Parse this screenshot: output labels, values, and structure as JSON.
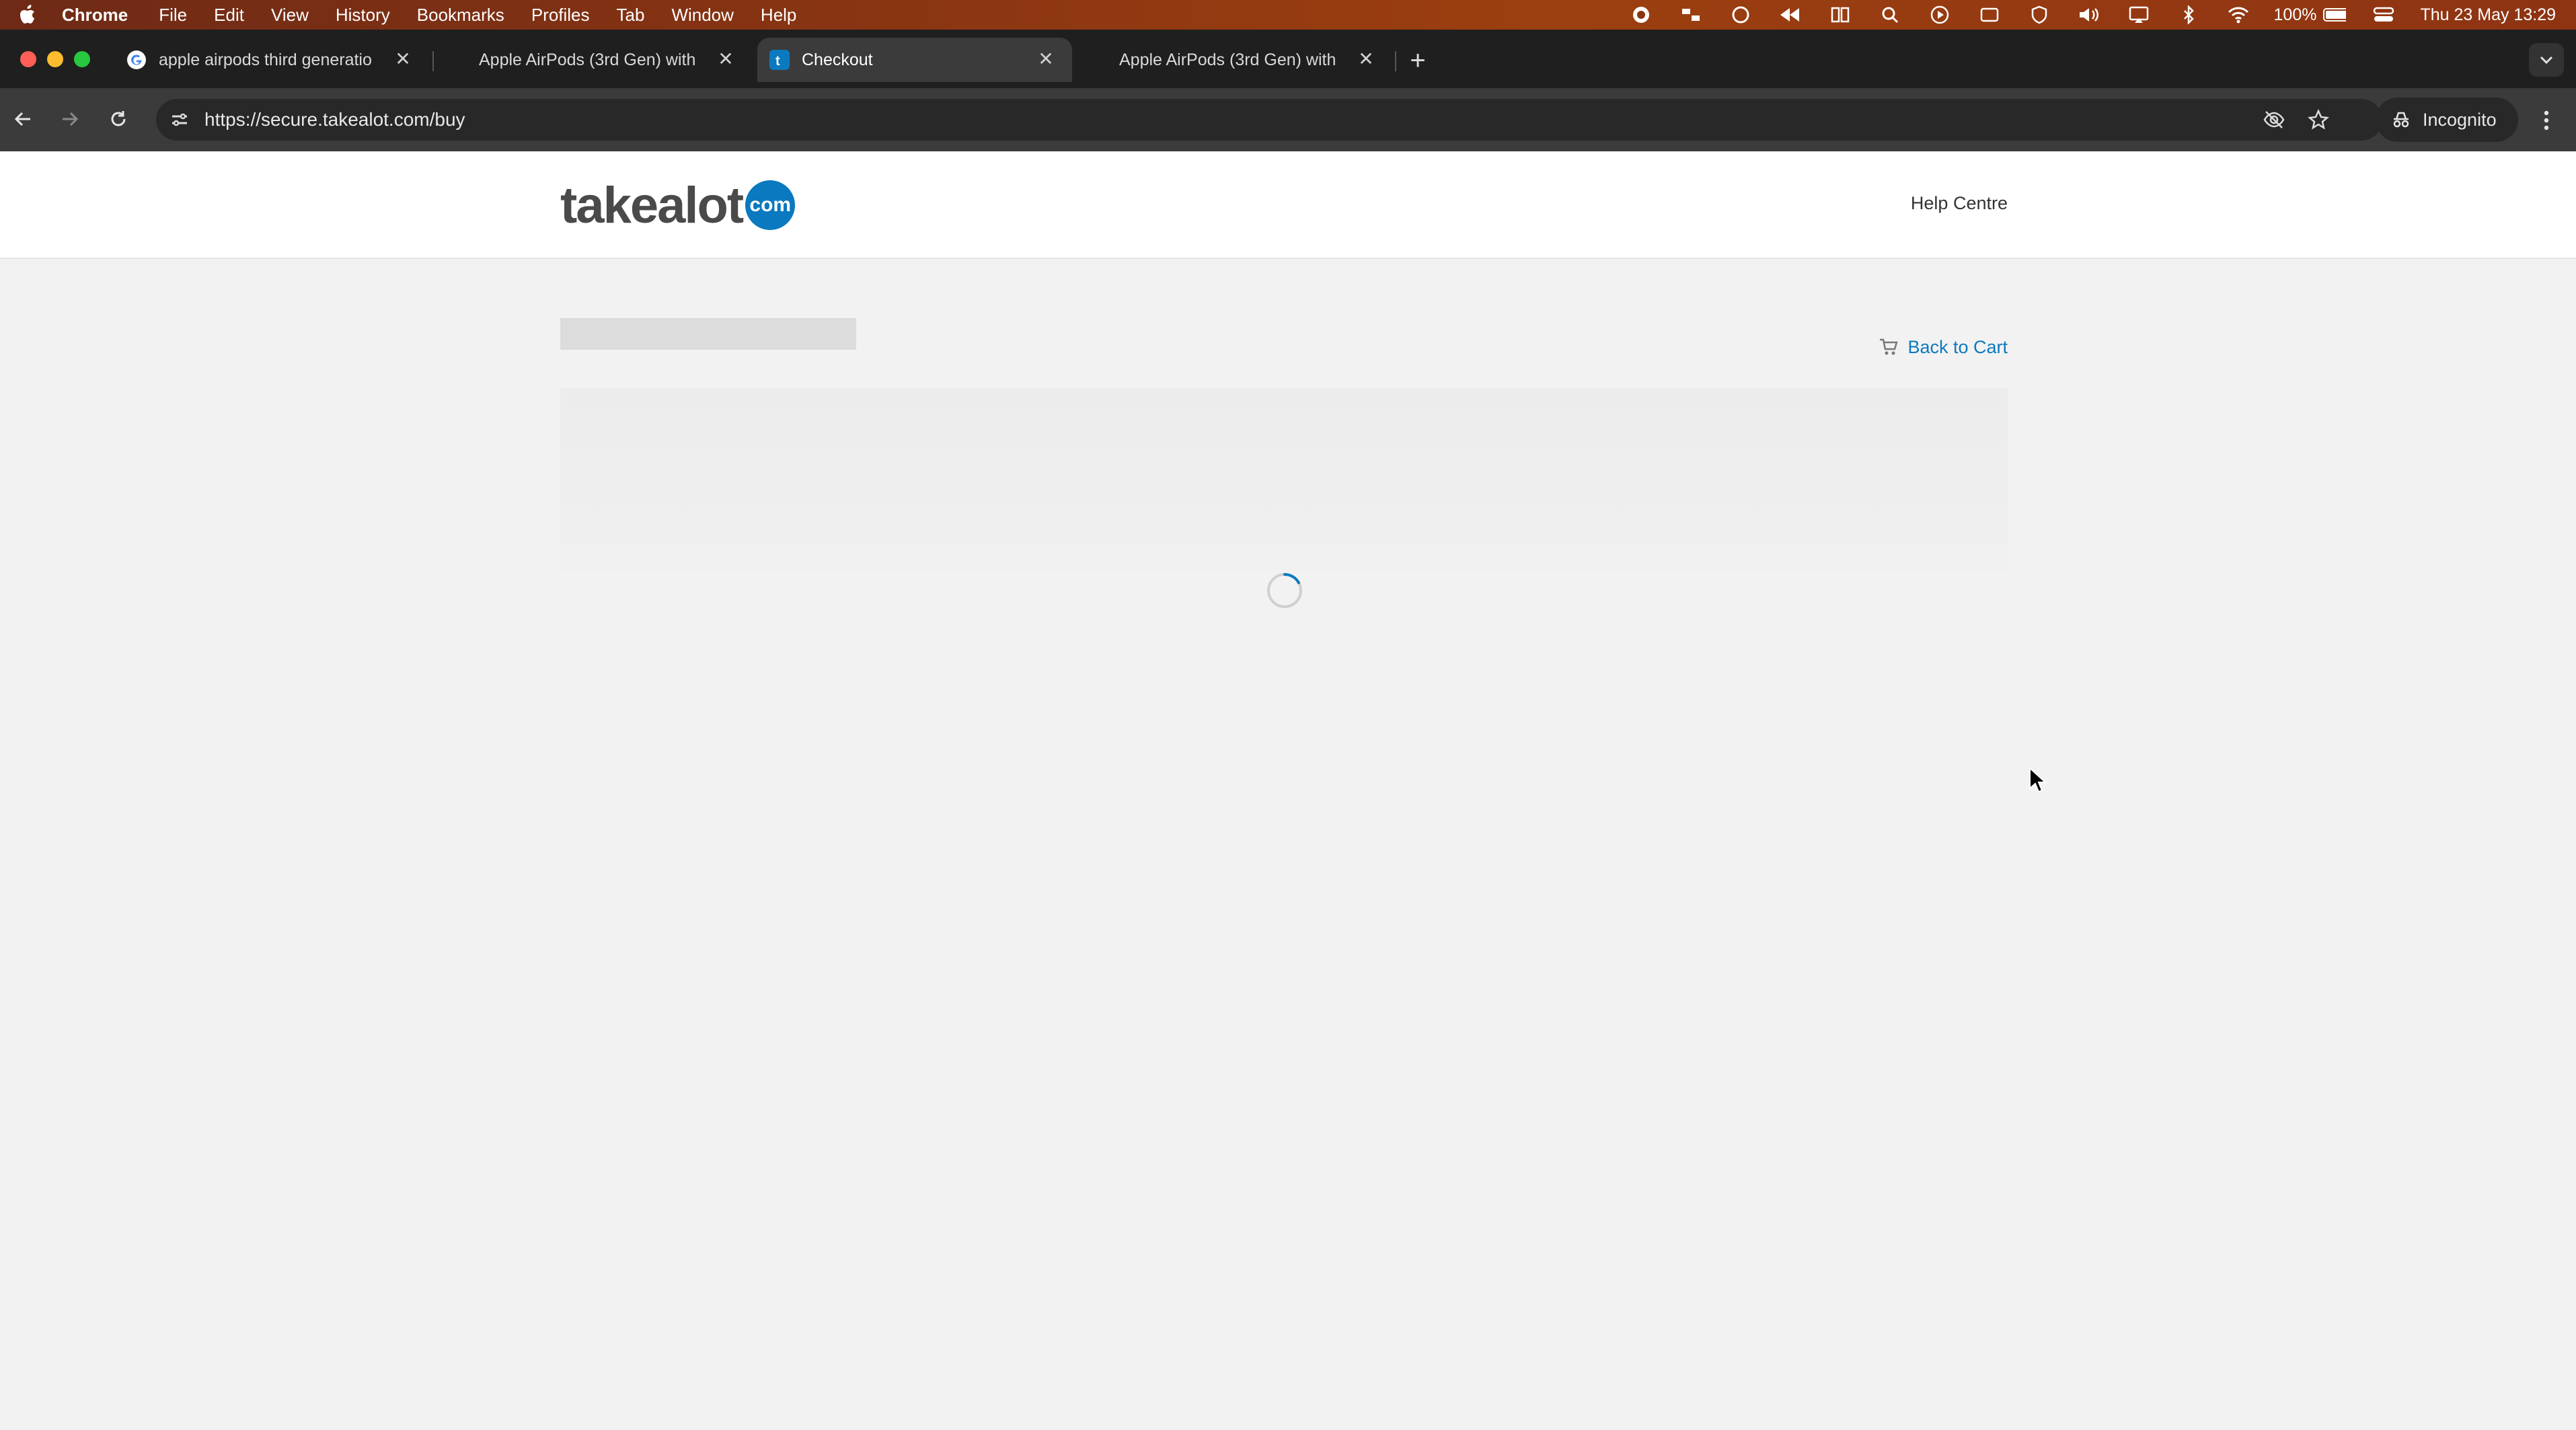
{
  "menubar": {
    "app_name": "Chrome",
    "items": [
      "File",
      "Edit",
      "View",
      "History",
      "Bookmarks",
      "Profiles",
      "Tab",
      "Window",
      "Help"
    ],
    "battery": "100%",
    "datetime": "Thu 23 May  13:29"
  },
  "tabs": [
    {
      "title": "apple airpods third generatio",
      "favicon": "google-icon",
      "active": false
    },
    {
      "title": "Apple AirPods (3rd Gen) with",
      "favicon": "none",
      "active": false
    },
    {
      "title": "Checkout",
      "favicon": "takealot-icon",
      "active": true
    },
    {
      "title": "Apple AirPods (3rd Gen) with",
      "favicon": "none",
      "active": false
    }
  ],
  "toolbar": {
    "url": "https://secure.takealot.com/buy",
    "incognito_label": "Incognito"
  },
  "site": {
    "logo_text": "takealot",
    "logo_badge": "com",
    "help_link": "Help Centre",
    "back_to_cart": "Back to Cart",
    "brand_color": "#0b79bf"
  },
  "page_state": {
    "loading": true
  }
}
